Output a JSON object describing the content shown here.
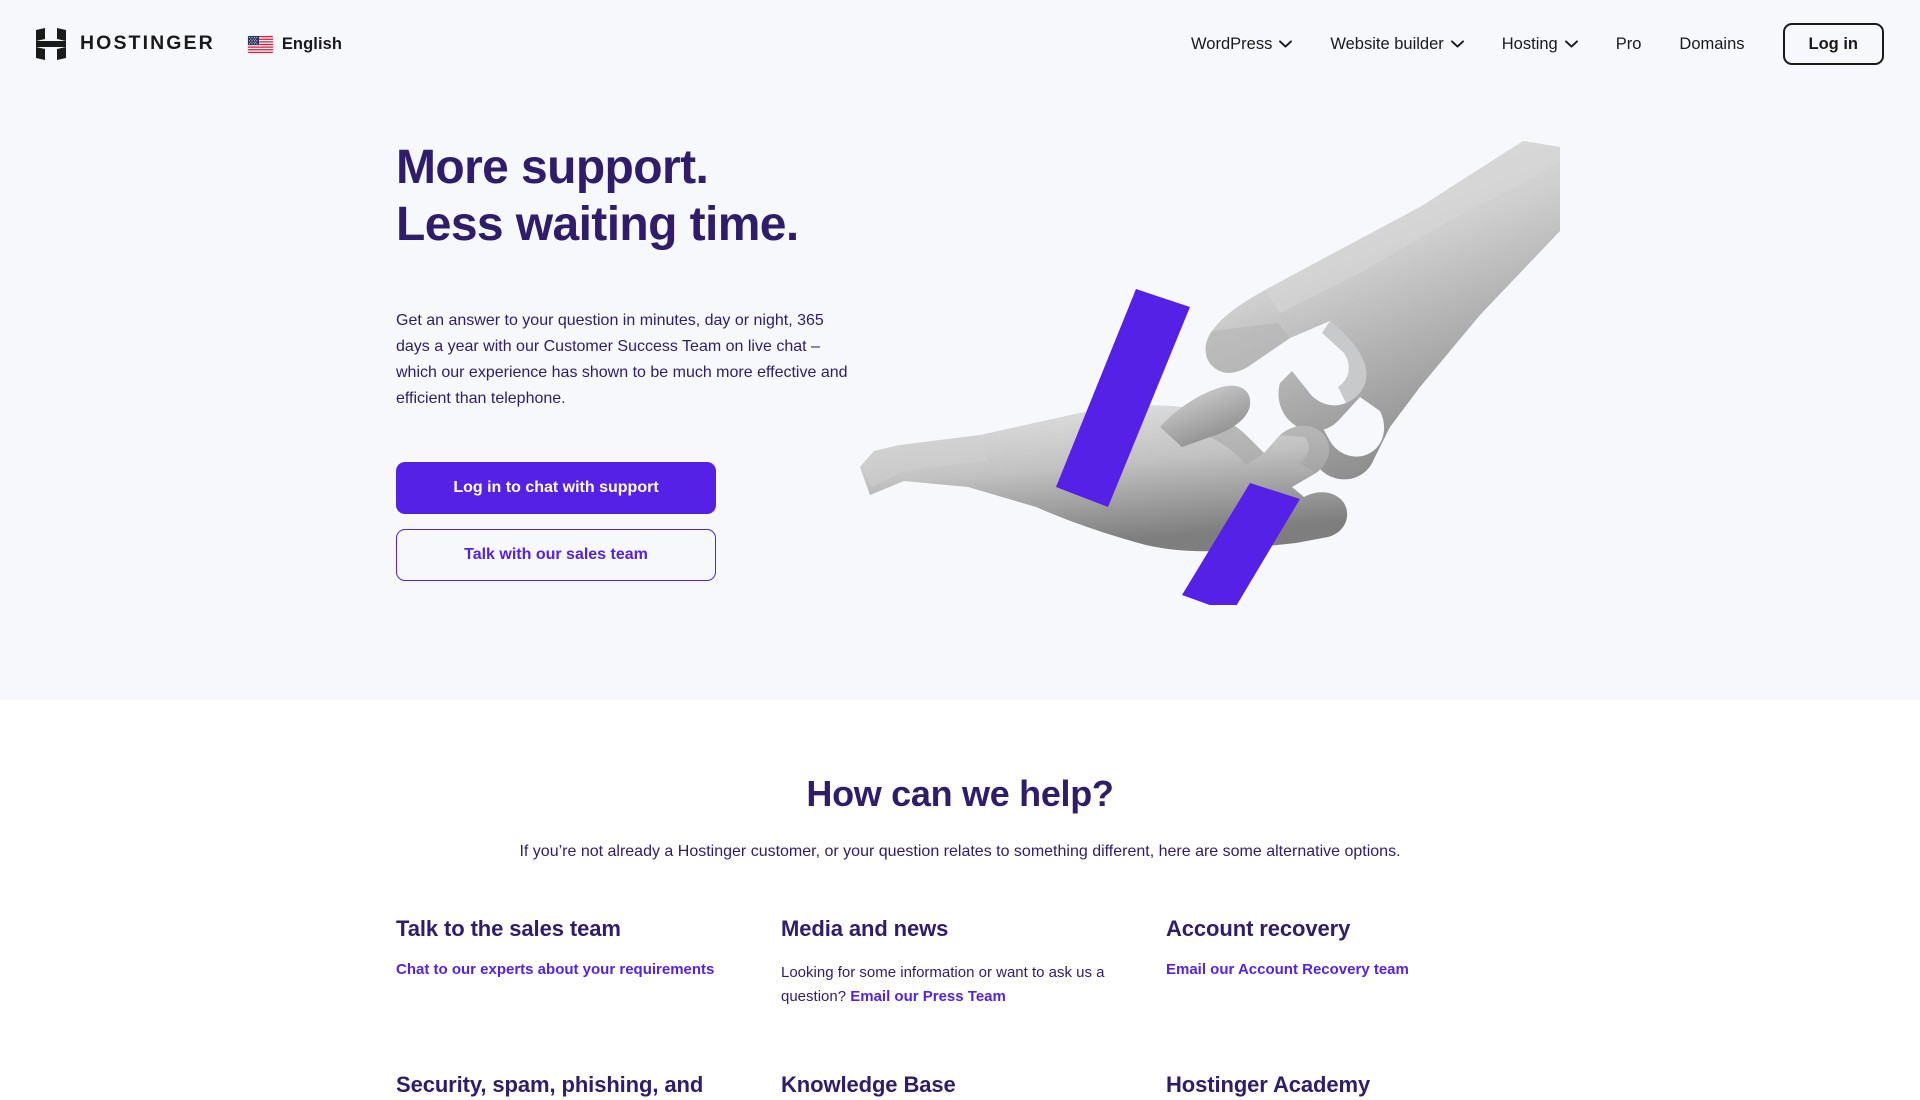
{
  "header": {
    "logo": {
      "icon": "hostinger-h-logo",
      "wordmark": "HOSTINGER"
    },
    "language": {
      "icon": "us-flag-icon",
      "label": "English"
    },
    "nav_items": [
      {
        "label": "WordPress",
        "has_caret": true
      },
      {
        "label": "Website builder",
        "has_caret": true
      },
      {
        "label": "Hosting",
        "has_caret": true
      },
      {
        "label": "Pro",
        "has_caret": false
      },
      {
        "label": "Domains",
        "has_caret": false
      }
    ],
    "login_label": "Log in"
  },
  "hero": {
    "title": "More support.\nLess waiting time.",
    "paragraph": "Get an answer to your question in minutes, day or night, 365 days a year with our Customer Success Team on live chat – which our experience has shown to be much more effective and efficient than telephone.",
    "primary_button": "Log in to chat with support",
    "secondary_button": "Talk with our sales team",
    "artwork": "two-hands-reaching-collage"
  },
  "help": {
    "title": "How can we help?",
    "subtitle": "If you’re not already a Hostinger customer, or your question relates to something different, here are some alternative options.",
    "cards": [
      {
        "title": "Talk to the sales team",
        "body": "",
        "link": "Chat to our experts about your requirements",
        "link_only": true
      },
      {
        "title": "Media and news",
        "body": "Looking for some information or want to ask us a question? ",
        "link": "Email our Press Team",
        "link_only": false
      },
      {
        "title": "Account recovery",
        "body": "",
        "link": "Email our Account Recovery team",
        "link_only": true
      },
      {
        "title": "Security, spam, phishing, and",
        "body": "",
        "link": "",
        "link_only": true
      },
      {
        "title": "Knowledge Base",
        "body": "",
        "link": "",
        "link_only": true
      },
      {
        "title": "Hostinger Academy",
        "body": "",
        "link": "",
        "link_only": true
      }
    ]
  },
  "colors": {
    "accent_purple": "#5521E6",
    "heading_navy": "#2F1C6A",
    "hero_background": "#F7F8FC",
    "page_background": "#FFFFFF",
    "text_dark": "#1A1A1A"
  }
}
